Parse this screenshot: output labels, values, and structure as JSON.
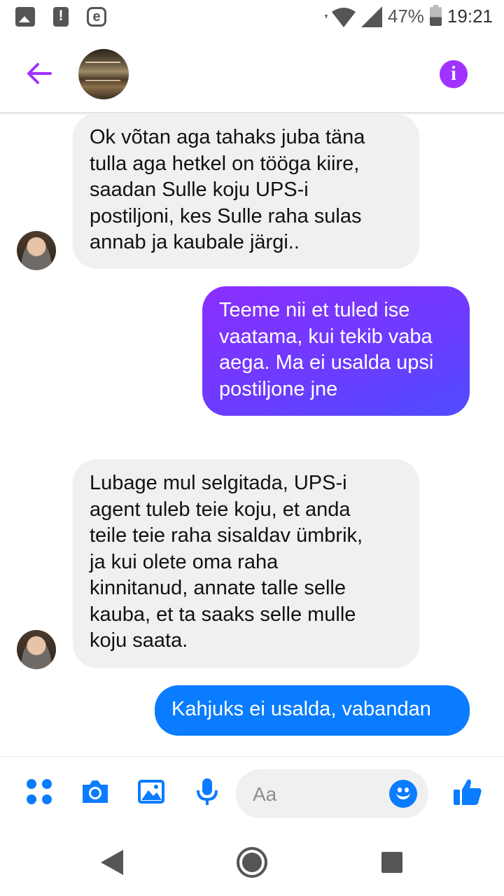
{
  "status_bar": {
    "battery": "47%",
    "time": "19:21",
    "left_icons": [
      "image-icon",
      "alert-icon",
      "e-app-icon"
    ],
    "right_icons": [
      "wifi-icon",
      "signal-icon",
      "battery-icon"
    ]
  },
  "header": {
    "back_icon": "arrow-left-icon",
    "info_icon": "info-icon",
    "accent_color": "#a033ff"
  },
  "messages": [
    {
      "direction": "incoming",
      "text": "Ok võtan aga tahaks juba täna\ntulla aga hetkel on tööga kiire,\nsaadan Sulle koju UPS-i\npostiljoni, kes Sulle raha sulas\nannab ja kaubale järgi.."
    },
    {
      "direction": "outgoing",
      "text": "Teeme nii et tuled ise\nvaatama, kui tekib vaba\naega. Ma ei usalda upsi\npostiljone jne"
    },
    {
      "direction": "incoming",
      "text": "Lubage mul selgitada, UPS-i\nagent tuleb teie koju, et anda\nteile teie raha sisaldav ümbrik,\nja kui olete oma raha\nkinnitanud, annate talle selle\nkauba, et ta saaks selle mulle\nkoju saata."
    },
    {
      "direction": "outgoing",
      "text": "Kahjuks ei usalda, vabandan"
    }
  ],
  "composer": {
    "placeholder": "Aa",
    "icons": [
      "more-apps-icon",
      "camera-icon",
      "gallery-icon",
      "microphone-icon",
      "emoji-icon",
      "thumbs-up-icon"
    ],
    "accent_color": "#0a7cff"
  },
  "nav_bar": {
    "icons": [
      "back-triangle-icon",
      "home-circle-icon",
      "recents-square-icon"
    ]
  }
}
